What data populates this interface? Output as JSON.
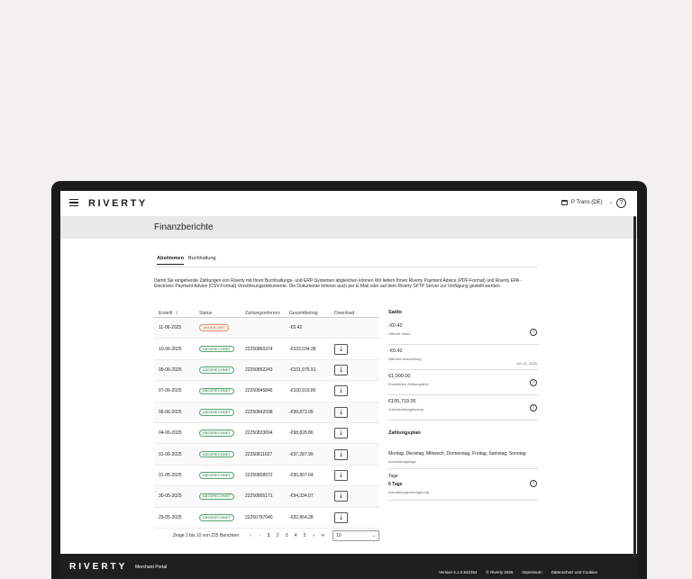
{
  "app": {
    "logo": "RIVERTY",
    "merchant": "P Trans (DE)",
    "help": "?"
  },
  "page": {
    "title": "Finanzberichte"
  },
  "tabs": [
    {
      "label": "Abstimmen"
    },
    {
      "label": "Buchhaltung"
    }
  ],
  "description": "Damit Sie eingehende Zahlungen von Riverty mit Ihren Buchhaltungs- und ERP-Systemen abgleichen können Wir liefern Ihnen Riverty Payment Advice (PDF-Format) und Riverty EPA - Electronic Payment Advice (CSV-Format) Versöhnungsdokumente. Die Dokumente können auch per E-Mail oder auf dem Riverty SFTP Server zur Verfügung gestellt werden.",
  "table": {
    "headers": [
      "Erstellt",
      "Status",
      "Zahlungsreferenz",
      "Gesamtbetrag",
      "Download"
    ],
    "rows": [
      {
        "date": "11-06-2025",
        "status": "UNGEKLÄRT",
        "ref": "",
        "amount": "-€0.42",
        "download": false
      },
      {
        "date": "10-06-2025",
        "status": "ABGERECHNET",
        "ref": "22250860374",
        "amount": "-€103,034.38",
        "download": true
      },
      {
        "date": "09-06-2025",
        "status": "ABGERECHNET",
        "ref": "22250852243",
        "amount": "-€101,976.91",
        "download": true
      },
      {
        "date": "07-06-2025",
        "status": "ABGERECHNET",
        "ref": "22250845846",
        "amount": "-€100,919.86",
        "download": true
      },
      {
        "date": "06-06-2025",
        "status": "ABGERECHNET",
        "ref": "22250842038",
        "amount": "-€99,872.05",
        "download": true
      },
      {
        "date": "04-06-2025",
        "status": "ABGERECHNET",
        "ref": "22250833694",
        "amount": "-€98,828.86",
        "download": true
      },
      {
        "date": "01-06-2025",
        "status": "ABGERECHNET",
        "ref": "22250811027",
        "amount": "-€97,287.99",
        "download": true
      },
      {
        "date": "31-05-2025",
        "status": "ABGERECHNET",
        "ref": "22250808972",
        "amount": "-€96,807.64",
        "download": true
      },
      {
        "date": "30-05-2025",
        "status": "ABGERECHNET",
        "ref": "22250805171",
        "amount": "-€94,334.07",
        "download": true
      },
      {
        "date": "29-05-2025",
        "status": "ABGERECHNET",
        "ref": "22250797040",
        "amount": "-€92,864.28",
        "download": true
      }
    ]
  },
  "pagination": {
    "info": "Zeige 1 bis 10 von 225 Berichten",
    "pages": [
      "1",
      "2",
      "3",
      "4",
      "5"
    ],
    "current": "1",
    "page_size": "10"
  },
  "saldo": {
    "title": "Saldo",
    "items": [
      {
        "amount": "-€0.42",
        "label": "Offener Saldo",
        "date": ""
      },
      {
        "amount": "-€0.42",
        "label": "Nächste Auszahlung",
        "date": "Jun 11, 2025"
      },
      {
        "amount": "€1,000.00",
        "label": "Erweitertes Zahlungslimit",
        "date": ""
      },
      {
        "amount": "€105,719.26",
        "label": "Zurückhaltungsbetrag",
        "date": ""
      }
    ]
  },
  "zahlungsplan": {
    "title": "Zahlungsplan",
    "days": "Montag, Dienstag, Mittwoch, Donnerstag, Freitag, Samstag, Sonntag",
    "days_label": "Auszahlungstage",
    "tage_title": "Tage",
    "tage_value": "0 Tage",
    "tage_label": "Auszahlungsverzögerung"
  },
  "footer": {
    "logo": "RIVERTY",
    "portal": "Merchant Portal",
    "version": "Version 4.1.0.542354",
    "copyright": "© Riverty 2025",
    "impressum": "Impressum",
    "privacy": "Datenschutz und Cookies"
  }
}
